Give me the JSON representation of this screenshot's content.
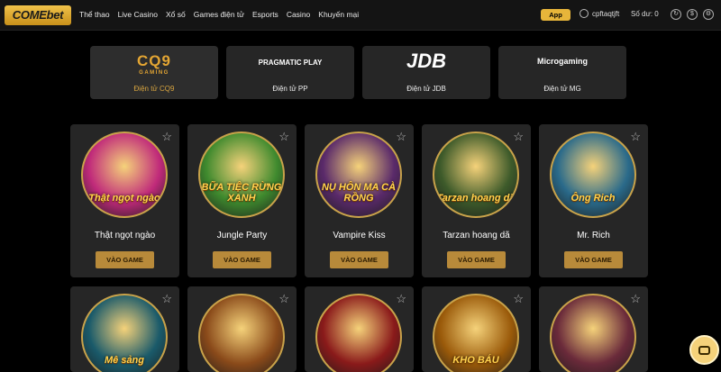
{
  "header": {
    "logo": "COMEbet",
    "nav": [
      "Thể thao",
      "Live Casino",
      "Xổ số",
      "Games điện tử",
      "Esports",
      "Casino",
      "Khuyến mại"
    ],
    "app_button": "App",
    "username": "cpftaqtjft",
    "balance_label": "Số dư:",
    "balance_value": "0"
  },
  "providers": [
    {
      "logo": "CQ9",
      "logo_sub": "GAMING",
      "label": "Điện tử CQ9"
    },
    {
      "logo": "PRAGMATIC PLAY",
      "label": "Điện tử PP"
    },
    {
      "logo": "JDB",
      "label": "Điện tử JDB"
    },
    {
      "logo": "Microgaming",
      "label": "Điện tử MG"
    }
  ],
  "games": [
    {
      "name": "Thật ngọt ngào",
      "thumb_title": "Thật ngọt ngào",
      "button": "VÀO GAME",
      "color": "#c02a7a"
    },
    {
      "name": "Jungle Party",
      "thumb_title": "BỮA TIỆC RỪNG XANH",
      "button": "VÀO GAME",
      "color": "#3f8a2e"
    },
    {
      "name": "Vampire Kiss",
      "thumb_title": "NỤ HÔN MA CÀ RỒNG",
      "button": "VÀO GAME",
      "color": "#5a2a6a"
    },
    {
      "name": "Tarzan hoang dã",
      "thumb_title": "Tarzan hoang dã",
      "button": "VÀO GAME",
      "color": "#3d5a2a"
    },
    {
      "name": "Mr. Rich",
      "thumb_title": "Ông Rich",
      "button": "VÀO GAME",
      "color": "#2a6a8a"
    },
    {
      "name": "",
      "thumb_title": "Mê sảng",
      "button": "",
      "color": "#1a5a6a"
    },
    {
      "name": "",
      "thumb_title": "",
      "button": "",
      "color": "#8a4a1a"
    },
    {
      "name": "",
      "thumb_title": "",
      "button": "",
      "color": "#8a1a1a"
    },
    {
      "name": "",
      "thumb_title": "KHO BÁU",
      "button": "",
      "color": "#9a5a0a"
    },
    {
      "name": "",
      "thumb_title": "",
      "button": "",
      "color": "#6a2a3a"
    }
  ]
}
